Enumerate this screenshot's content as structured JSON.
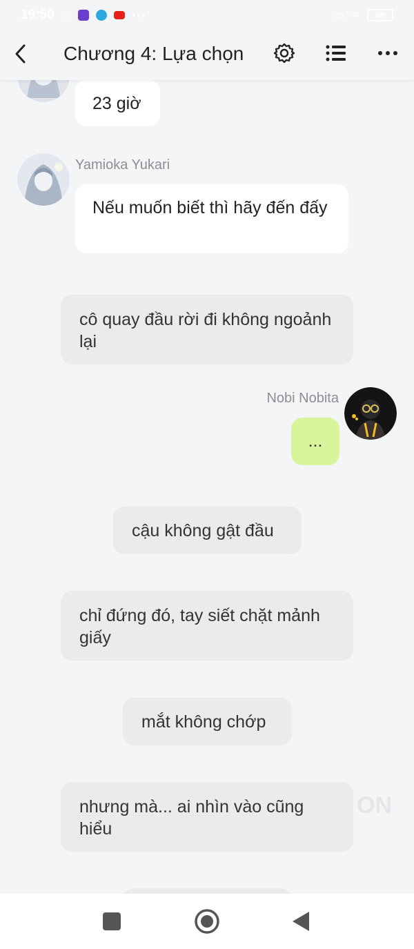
{
  "status_bar": {
    "time": "19:50",
    "battery": "100"
  },
  "header": {
    "title": "Chương 4: Lựa chọn"
  },
  "messages": {
    "m1": {
      "text": "23 giờ"
    },
    "m2": {
      "sender": "Yamioka Yukari",
      "text": "Nếu muốn biết thì hãy đến đấy"
    },
    "m3": {
      "text": "cô quay đầu rời đi không ngoảnh lại"
    },
    "m4": {
      "sender": "Nobi Nobita",
      "text": "..."
    },
    "m5": {
      "text": "cậu không gật đầu"
    },
    "m6": {
      "text": "chỉ đứng đó, tay siết chặt mảnh giấy"
    },
    "m7": {
      "text": "mắt không chớp"
    },
    "m8": {
      "text": "nhưng mà... ai nhìn vào cũng hiểu"
    }
  },
  "watermark": "ON",
  "icons": {
    "back": "chevron-left-icon",
    "settings": "gear-icon",
    "list": "list-icon",
    "more": "more-dots-icon",
    "nav_recent": "square-icon",
    "nav_home": "circle-icon",
    "nav_back": "triangle-back-icon"
  },
  "colors": {
    "background": "#f4f5f7",
    "self_bubble": "#d9f59b",
    "narration_bubble": "#ebebec"
  }
}
